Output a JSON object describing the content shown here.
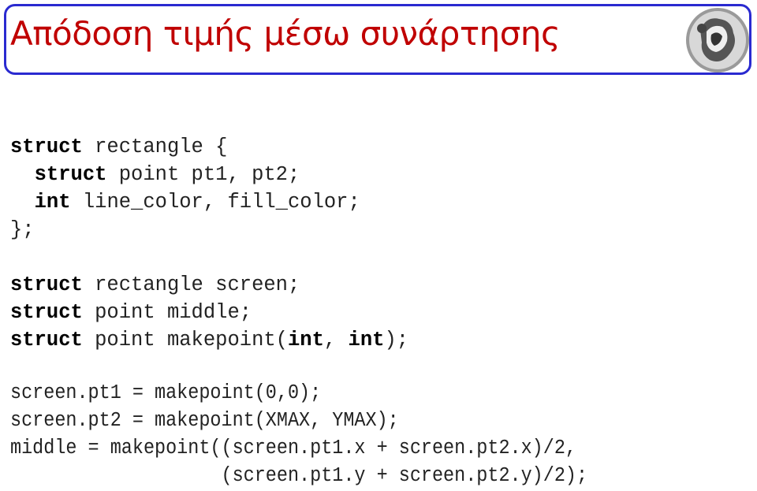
{
  "title": "Απόδοση τιμής μέσω συνάρτησης",
  "logo": "university-coin-logo",
  "colors": {
    "title": "#c00000",
    "border": "#2a2ad0"
  },
  "block1": [
    [
      {
        "k": "struct"
      },
      {
        "t": " rectangle {"
      }
    ],
    [
      {
        "t": "  "
      },
      {
        "k": "struct"
      },
      {
        "t": " point pt1, pt2;"
      }
    ],
    [
      {
        "t": "  "
      },
      {
        "k": "int"
      },
      {
        "t": " line_color, fill_color;"
      }
    ],
    [
      {
        "t": "};"
      }
    ]
  ],
  "block2": [
    [
      {
        "k": "struct"
      },
      {
        "t": " rectangle screen;"
      }
    ],
    [
      {
        "k": "struct"
      },
      {
        "t": " point middle;"
      }
    ],
    [
      {
        "k": "struct"
      },
      {
        "t": " point makepoint("
      },
      {
        "k": "int"
      },
      {
        "t": ", "
      },
      {
        "k": "int"
      },
      {
        "t": ");"
      }
    ]
  ],
  "block3": [
    "screen.pt1 = makepoint(0,0);",
    "screen.pt2 = makepoint(XMAX, YMAX);",
    "middle = makepoint((screen.pt1.x + screen.pt2.x)/2,",
    "                   (screen.pt1.y + screen.pt2.y)/2);"
  ]
}
